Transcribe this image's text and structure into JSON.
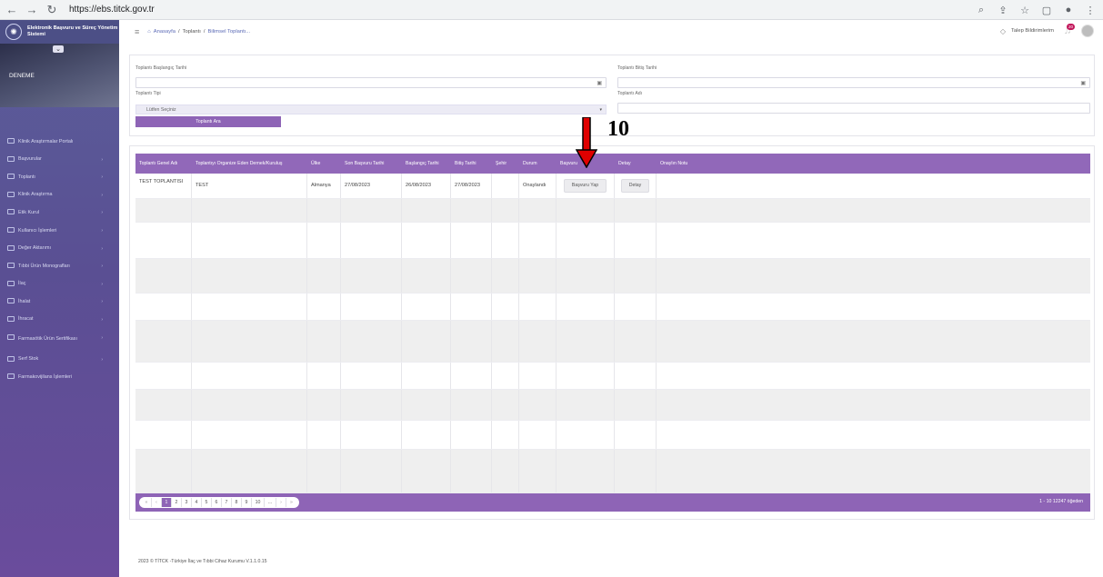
{
  "browser": {
    "url": "https://ebs.titck.gov.tr"
  },
  "sidebar": {
    "brand": "Elektronik Başvuru ve Süreç Yönetim Sistemi",
    "user_name": "DENEME",
    "items": [
      {
        "label": "Klinik Araştırmalar Portalı"
      },
      {
        "label": "Başvurular"
      },
      {
        "label": "Toplantı"
      },
      {
        "label": "Klinik Araştırma"
      },
      {
        "label": "Etik Kurul"
      },
      {
        "label": "Kullanıcı İşlemleri"
      },
      {
        "label": "Değer Aktarımı"
      },
      {
        "label": "Tıbbi Ürün Monografları"
      },
      {
        "label": "İlaç"
      },
      {
        "label": "İhalat"
      },
      {
        "label": "İhracat"
      },
      {
        "label": "Farmasötik Ürün Sertifikası"
      },
      {
        "label": "Serf Stok"
      },
      {
        "label": "Farmakovijilans İşlemleri"
      }
    ]
  },
  "topbar": {
    "breadcrumb": [
      "Anasayfa",
      "/",
      "Toplantı",
      "/",
      "Bilimsel Toplantı..."
    ],
    "notifications_label": "Talep Bildirimlerim",
    "badge": "20"
  },
  "filter": {
    "start_date_label": "Toplantı Başlangıç Tarihi",
    "end_date_label": "Toplantı Bitiş Tarihi",
    "type_label": "Toplantı Tipi",
    "type_value": "Lütfen Seçiniz",
    "name_label": "Toplantı Adı",
    "search_button": "Toplantı Ara"
  },
  "table": {
    "columns": [
      "Toplantı Genel Adı",
      "Toplantıyı Organize Eden Dernek/Kuruluş",
      "Ülke",
      "Son Başvuru Tarihi",
      "Başlangıç Tarihi",
      "Bitiş Tarihi",
      "Şehir",
      "Durum",
      "Başvuru",
      "Detay",
      "Onaylın Notu"
    ],
    "rows": [
      {
        "name": "TEST TOPLANTISI",
        "organizer": "TEST",
        "country": "Almanya",
        "deadline": "27/08/2023",
        "start": "26/08/2023",
        "end": "27/08/2023",
        "city": "",
        "status": "Onaylandı",
        "apply_button": "Başvuru Yap",
        "detail_button": "Detay",
        "note": ""
      }
    ],
    "pagination": {
      "first": "«",
      "prev": "‹",
      "pages": [
        "1",
        "2",
        "3",
        "4",
        "5",
        "6",
        "7",
        "8",
        "9",
        "10",
        "..."
      ],
      "next": "›",
      "last": "»",
      "info": "1 - 10 12247 öğeden"
    }
  },
  "footer": "2023 © TİTCK -Türkiye İlaç ve Tıbbi Cihaz Kurumu V.1.1.0.15",
  "annotation": {
    "number": "10",
    "arrow_color": "#e00000"
  }
}
